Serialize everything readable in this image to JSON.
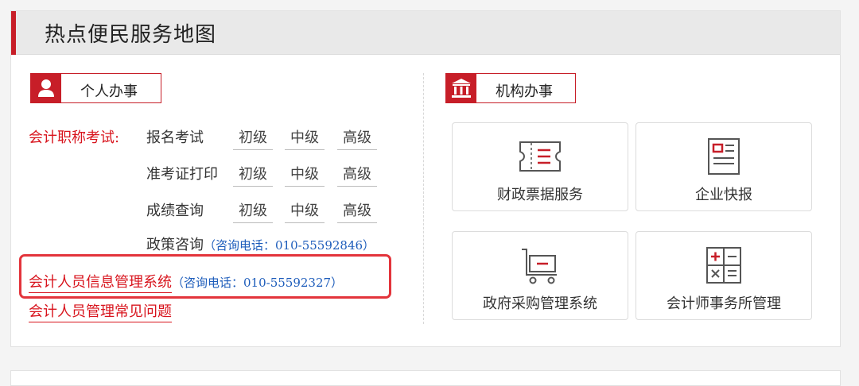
{
  "panel": {
    "title": "热点便民服务地图"
  },
  "personal": {
    "tab_label": "个人办事",
    "exam_label": "会计职称考试:",
    "rows": [
      {
        "label": "报名考试",
        "levels": [
          "初级",
          "中级",
          "高级"
        ]
      },
      {
        "label": "准考证打印",
        "levels": [
          "初级",
          "中级",
          "高级"
        ]
      },
      {
        "label": "成绩查询",
        "levels": [
          "初级",
          "中级",
          "高级"
        ]
      }
    ],
    "policy_label": "政策咨询",
    "policy_phone": "（咨询电话：010-55592846）",
    "info_system_label": "会计人员信息管理系统",
    "info_system_phone": "（咨询电话：010-55592327）",
    "faq_label": "会计人员管理常见问题"
  },
  "institution": {
    "tab_label": "机构办事",
    "cards": [
      {
        "label": "财政票据服务",
        "icon": "ticket-icon"
      },
      {
        "label": "企业快报",
        "icon": "id-card-icon"
      },
      {
        "label": "政府采购管理系统",
        "icon": "cart-icon"
      },
      {
        "label": "会计师事务所管理",
        "icon": "calculator-icon"
      }
    ]
  },
  "colors": {
    "accent": "#c71e28",
    "link_red": "#d8141d",
    "phone_blue": "#1e5dbb",
    "highlight": "#e3343b"
  }
}
